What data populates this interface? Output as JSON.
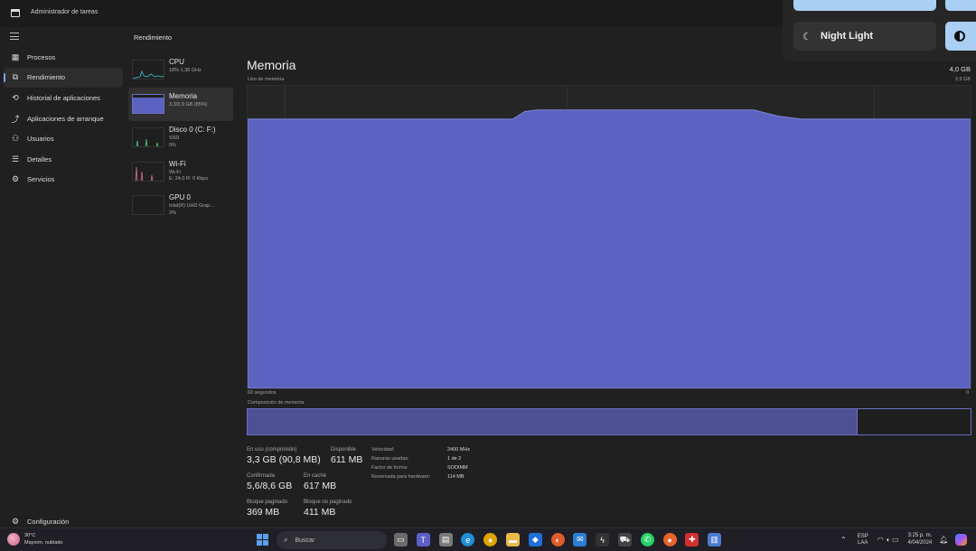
{
  "app": {
    "title": "Administrador de tareas",
    "section_title": "Rendimiento"
  },
  "nav": {
    "items": [
      {
        "label": "Procesos",
        "icon": "grid-icon"
      },
      {
        "label": "Rendimiento",
        "icon": "performance-icon"
      },
      {
        "label": "Historial de aplicaciones",
        "icon": "history-icon"
      },
      {
        "label": "Aplicaciones de arranque",
        "icon": "startup-icon"
      },
      {
        "label": "Usuarios",
        "icon": "users-icon"
      },
      {
        "label": "Detalles",
        "icon": "details-icon"
      },
      {
        "label": "Servicios",
        "icon": "services-icon"
      }
    ],
    "settings_label": "Configuración"
  },
  "perf_list": [
    {
      "name": "CPU",
      "sub1": "18% 1,38 GHz",
      "sub2": ""
    },
    {
      "name": "Memoria",
      "sub1": "3,3/3,9 GB (85%)",
      "sub2": ""
    },
    {
      "name": "Disco 0 (C: F:)",
      "sub1": "SSD",
      "sub2": "0%"
    },
    {
      "name": "Wi-Fi",
      "sub1": "Wi-Fi",
      "sub2": "E: 24,0 R: 0 Kbps"
    },
    {
      "name": "GPU 0",
      "sub1": "Intel(R) UHD Grap...",
      "sub2": "2%"
    }
  ],
  "memory": {
    "title": "Memoria",
    "usage_label": "Uso de memoria",
    "max_total": "4,0 GB",
    "max_scale": "3,9 GB",
    "time_span": "60 segundos",
    "zero": "0",
    "composition_label": "Composición de memoria",
    "composition_in_use_fraction": 0.844,
    "usage_history_fraction": [
      0.89,
      0.89,
      0.89,
      0.89,
      0.89,
      0.89,
      0.89,
      0.89,
      0.89,
      0.89,
      0.89,
      0.89,
      0.89,
      0.89,
      0.89,
      0.89,
      0.89,
      0.89,
      0.89,
      0.89,
      0.89,
      0.89,
      0.89,
      0.915,
      0.92,
      0.92,
      0.92,
      0.92,
      0.92,
      0.92,
      0.92,
      0.92,
      0.92,
      0.92,
      0.92,
      0.92,
      0.92,
      0.92,
      0.92,
      0.92,
      0.92,
      0.92,
      0.92,
      0.91,
      0.9,
      0.895,
      0.89,
      0.89,
      0.89,
      0.89,
      0.89,
      0.89,
      0.89,
      0.89,
      0.89,
      0.89,
      0.89,
      0.89,
      0.89,
      0.89,
      0.89
    ],
    "stats": {
      "in_use_label": "En uso (comprimido)",
      "in_use_value": "3,3 GB (90,8 MB)",
      "available_label": "Disponible",
      "available_value": "611 MB",
      "committed_label": "Confirmada",
      "committed_value": "5,6/8,6 GB",
      "cached_label": "En caché",
      "cached_value": "617 MB",
      "paged_label": "Bloque paginado",
      "paged_value": "369 MB",
      "nonpaged_label": "Bloque no paginado",
      "nonpaged_value": "411 MB"
    },
    "props": [
      {
        "key": "Velocidad:",
        "value": "2400 MHz"
      },
      {
        "key": "Ranuras usadas:",
        "value": "1 de 2"
      },
      {
        "key": "Factor de forma:",
        "value": "SODIMM"
      },
      {
        "key": "Reservada para hardware:",
        "value": "114 MB"
      }
    ]
  },
  "quick_settings": {
    "night_light_label": "Night Light"
  },
  "taskbar": {
    "weather_temp": "30°C",
    "weather_desc": "Mayorm. nublado",
    "search_placeholder": "Buscar",
    "lang_top": "ESP",
    "lang_bottom": "LAA",
    "time": "3:25 p. m.",
    "date": "4/04/2024"
  },
  "colors": {
    "memory_fill": "#5b62c0",
    "memory_line": "#7f86e0",
    "accent": "#a9cff4"
  }
}
